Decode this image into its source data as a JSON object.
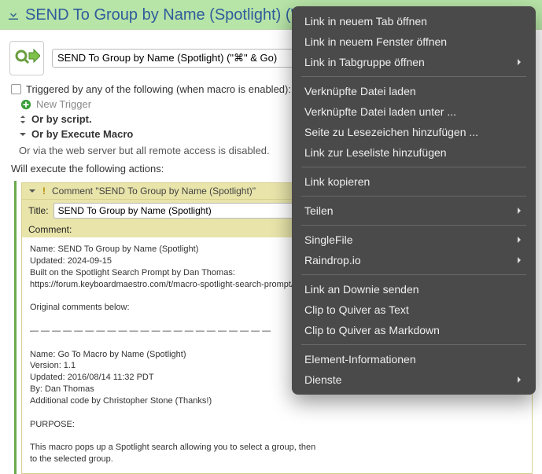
{
  "header": {
    "title": "SEND To Group by Name (Spotlight) (\"⌘\""
  },
  "nameField": {
    "value": "SEND To Group by Name (Spotlight) (\"⌘\" & Go)"
  },
  "triggers": {
    "checkboxLabel": "Triggered by any of the following (when macro is enabled):",
    "newTrigger": "New Trigger",
    "byScript": "Or by script.",
    "byExecuteMacro": "Or by Execute Macro",
    "note": "Or via the web server but all remote access is disabled.",
    "willExecute": "Will execute the following actions:"
  },
  "action": {
    "headerText": "Comment \"SEND To Group by Name (Spotlight)\"",
    "titleLabel": "Title:",
    "titleValue": "SEND To Group by Name (Spotlight)",
    "commentLabel": "Comment:",
    "commentBody": "Name: SEND To Group by Name (Spotlight)\nUpdated: 2024-09-15\nBuilt on the Spotlight Search Prompt by Dan Thomas:\nhttps://forum.keyboardmaestro.com/t/macro-spotlight-search-prompt/4665\n\nOriginal comments below:\n\n— — — — — — — — — — — — — — — — — — — — — —\n\nName: Go To Macro by Name (Spotlight)\nVersion: 1.1\nUpdated: 2016/08/14 11:32 PDT\nBy: Dan Thomas\nAdditional code by Christopher Stone (Thanks!)\n\nPURPOSE:\n\nThis macro pops up a Spotlight search allowing you to select a group, then\nto the selected group."
  },
  "contextMenu": {
    "groups": [
      [
        {
          "label": "Link in neuem Tab öffnen",
          "submenu": false
        },
        {
          "label": "Link in neuem Fenster öffnen",
          "submenu": false
        },
        {
          "label": "Link in Tabgruppe öffnen",
          "submenu": true
        }
      ],
      [
        {
          "label": "Verknüpfte Datei laden",
          "submenu": false
        },
        {
          "label": "Verknüpfte Datei laden unter ...",
          "submenu": false
        },
        {
          "label": "Seite zu Lesezeichen hinzufügen ...",
          "submenu": false
        },
        {
          "label": "Link zur Leseliste hinzufügen",
          "submenu": false
        }
      ],
      [
        {
          "label": "Link kopieren",
          "submenu": false
        }
      ],
      [
        {
          "label": "Teilen",
          "submenu": true
        }
      ],
      [
        {
          "label": "SingleFile",
          "submenu": true
        },
        {
          "label": "Raindrop.io",
          "submenu": true
        }
      ],
      [
        {
          "label": "Link an Downie senden",
          "submenu": false
        },
        {
          "label": "Clip to Quiver as Text",
          "submenu": false
        },
        {
          "label": "Clip to Quiver as Markdown",
          "submenu": false
        }
      ],
      [
        {
          "label": "Element-Informationen",
          "submenu": false
        },
        {
          "label": "Dienste",
          "submenu": true
        }
      ]
    ]
  }
}
